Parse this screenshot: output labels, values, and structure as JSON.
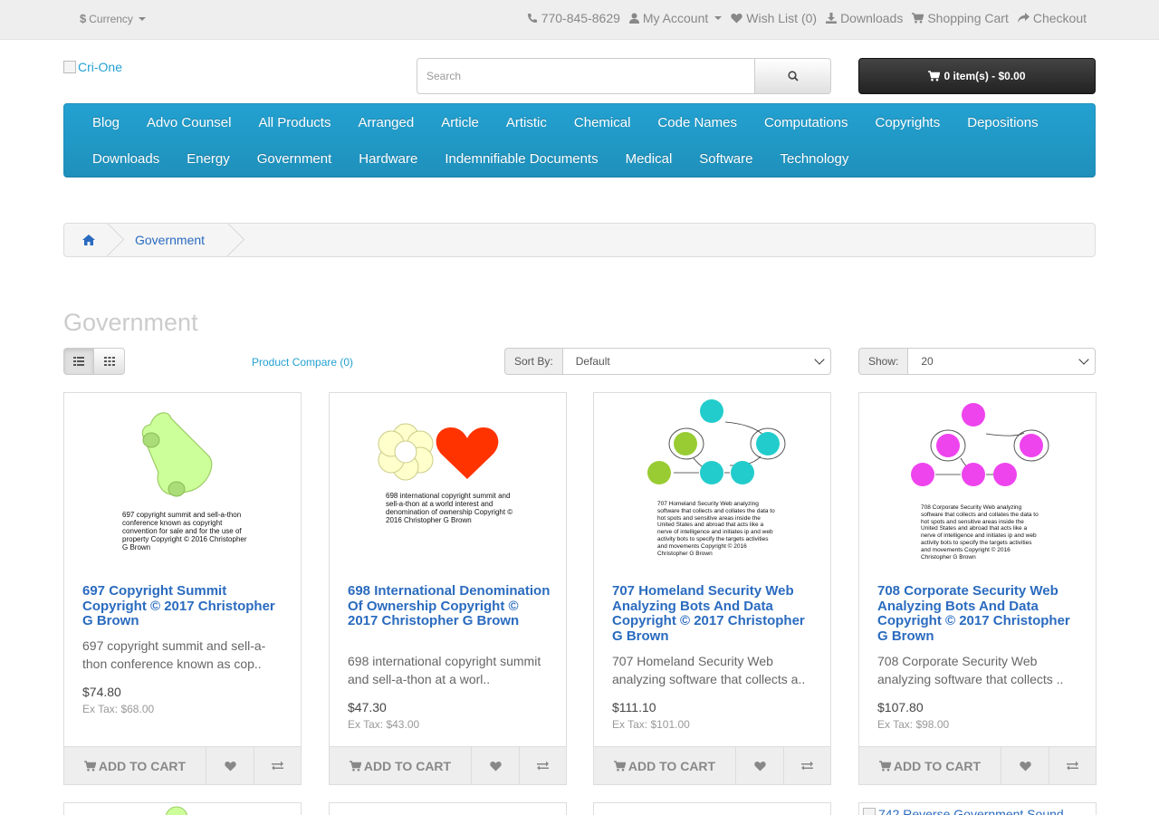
{
  "topbar": {
    "currency_symbol": "$",
    "currency_label": "Currency",
    "links": {
      "phone": "770-845-8629",
      "account": "My Account",
      "wishlist": "Wish List (0)",
      "downloads": "Downloads",
      "cart": "Shopping Cart",
      "checkout": "Checkout"
    }
  },
  "header": {
    "logo_alt": "Cri-One",
    "search_placeholder": "Search",
    "cart_button": "0 item(s) - $0.00"
  },
  "menu": {
    "row1": [
      "Blog",
      "Advo Counsel",
      "All Products",
      "Arranged",
      "Article",
      "Artistic",
      "Chemical",
      "Code Names",
      "Computations",
      "Copyrights",
      "Depositions"
    ],
    "row2": [
      "Downloads",
      "Energy",
      "Government",
      "Hardware",
      "Indemnifiable Documents",
      "Medical",
      "Software",
      "Technology"
    ]
  },
  "breadcrumb": {
    "current": "Government"
  },
  "page": {
    "title": "Government",
    "compare_link": "Product Compare (0)",
    "sort_label": "Sort By:",
    "sort_value": "Default",
    "show_label": "Show:",
    "show_value": "20"
  },
  "products": [
    {
      "title": "697 Copyright Summit Copyright © 2017 Christopher G Brown",
      "description": "697 copyright summit and sell-a-thon conference known as cop..",
      "price": "$74.80",
      "ex_tax": "Ex Tax: $68.00",
      "image_caption": "697 copyright summit and sell-a-thon conference known as copyright convention for sale and for the use of property Copyright © 2016 Christopher G Brown",
      "add_to_cart": "Add to Cart"
    },
    {
      "title": "698 International Denomination Of Ownership Copyright © 2017 Christopher G Brown",
      "description": "698 international copyright summit and sell-a-thon at a worl..",
      "price": "$47.30",
      "ex_tax": "Ex Tax: $43.00",
      "image_caption": "698 international copyright summit and sell-a-thon at a world interest and denomination of ownership Copyright © 2016 Christopher G Brown",
      "add_to_cart": "Add to Cart"
    },
    {
      "title": "707 Homeland Security Web Analyzing Bots And Data Copyright © 2017 Christopher G Brown",
      "description": "707 Homeland Security Web analyzing software that collects a..",
      "price": "$111.10",
      "ex_tax": "Ex Tax: $101.00",
      "image_caption": "707 Homeland Security Web analyzing software that collects and collates the data to hot spots and sensitive areas inside the United States and abroad that acts like a nerve of intelligence and initiates ip and web activity bots to specify the targets activities and movements Copyright © 2016 Christopher G Brown",
      "add_to_cart": "Add to Cart"
    },
    {
      "title": "708 Corporate Security Web Analyzing Bots And Data Copyright © 2017 Christopher G Brown",
      "description": "708 Corporate Security Web analyzing software that collects ..",
      "price": "$107.80",
      "ex_tax": "Ex Tax: $98.00",
      "image_caption": "708 Corporate Security Web analyzing software that collects and collates the data to hot spots and sensitive areas inside the United States and abroad that acts like a nerve of intelligence and initiates ip and web activity bots to specify the targets activities and movements Copyright © 2016 Christopher G Brown",
      "add_to_cart": "Add to Cart"
    }
  ],
  "next_row": {
    "fourth_partial": "742 Reverse Government Sound"
  },
  "colors": {
    "menu_blue": "#23a1d1",
    "link_blue": "#2a6bbf",
    "cart_dark": "#303030"
  }
}
